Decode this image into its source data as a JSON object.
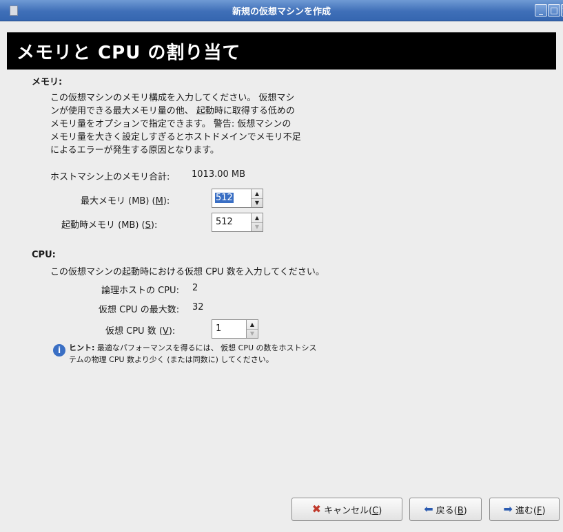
{
  "window": {
    "title": "新規の仮想マシンを作成"
  },
  "header": {
    "title": "メモリと CPU の割り当て"
  },
  "memory": {
    "section_title": "メモリ:",
    "description_lines": [
      "この仮想マシンのメモリ構成を入力してください。 仮想マシ",
      "ンが使用できる最大メモリ量の他、 起動時に取得する低めの",
      "メモリ量をオプションで指定できます。 警告: 仮想マシンの",
      "メモリ量を大きく設定しすぎるとホストドメインでメモリ不足",
      "によるエラーが発生する原因となります。"
    ],
    "host_total_label": "ホストマシン上のメモリ合計:",
    "host_total_value": "1013.00 MB",
    "max_label_prefix": "最大メモリ (MB) (",
    "max_label_key": "M",
    "max_label_suffix": "):",
    "max_value": "512",
    "startup_label_prefix": "起動時メモリ (MB) (",
    "startup_label_key": "S",
    "startup_label_suffix": "):",
    "startup_value": "512"
  },
  "cpu": {
    "section_title": "CPU:",
    "description": "この仮想マシンの起動時における仮想 CPU 数を入力してください。",
    "logical_label": "論理ホストの CPU:",
    "logical_value": "2",
    "max_label": "仮想 CPU の最大数:",
    "max_value": "32",
    "count_label_prefix": "仮想 CPU 数 (",
    "count_label_key": "V",
    "count_label_suffix": "):",
    "count_value": "1",
    "hint_bold": "ヒント:",
    "hint_line1": " 最適なパフォーマンスを得るには、 仮想 CPU の数をホストシス",
    "hint_line2": "テムの物理 CPU 数より少く (または同数に) してください。"
  },
  "footer": {
    "cancel_prefix": "キャンセル(",
    "cancel_key": "C",
    "cancel_suffix": ")",
    "back_prefix": "戻る(",
    "back_key": "B",
    "back_suffix": ")",
    "forward_prefix": "進む(",
    "forward_key": "F",
    "forward_suffix": ")"
  },
  "icons": {
    "app": "window-icon",
    "minimize": "minimize-icon",
    "maximize": "maximize-icon",
    "close": "close-icon",
    "hint": "info-icon",
    "cancel": "cancel-x-icon",
    "back": "back-arrow-icon",
    "forward": "forward-arrow-icon"
  },
  "colors": {
    "titlebar": "#3f6fb8",
    "banner": "#000000",
    "selection": "#3a6fc4"
  }
}
